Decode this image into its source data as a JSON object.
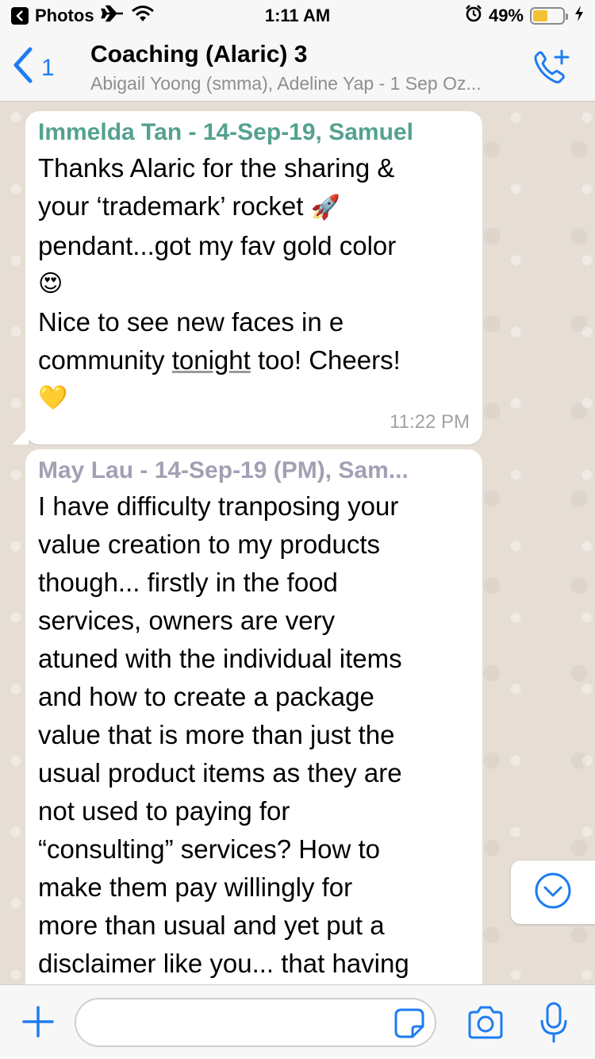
{
  "status_bar": {
    "back_app": "Photos",
    "time": "1:11 AM",
    "battery_percent": "49%",
    "battery_level": 0.49
  },
  "header": {
    "back_count": "1",
    "title": "Coaching (Alaric) 3",
    "subtitle": "Abigail Yoong (smma), Adeline Yap - 1 Sep Oz..."
  },
  "messages": [
    {
      "sender": "Immelda Tan - 14-Sep-19, Samuel",
      "sender_color": "#54a18f",
      "line1": "Thanks Alaric for the sharing &",
      "line2": "your ‘trademark’ rocket",
      "emoji_rocket": "🚀",
      "line3": "pendant...got my fav gold color",
      "emoji_heart_eyes": "😍",
      "line4": "Nice to see new faces in e",
      "line5a": "community",
      "line5b": "tonight",
      "line5c": "too! Cheers!",
      "emoji_yellow_heart": "💛",
      "time": "11:22 PM"
    },
    {
      "sender": "May Lau - 14-Sep-19 (PM), Sam...",
      "sender_color": "#a59fb4",
      "lines": [
        "I have difficulty tranposing your",
        "value creation to my products",
        "though... firstly in the food",
        "services, owners are very",
        "atuned with the individual items",
        "and how to create a package",
        "value that is more than just the",
        "usual product items as they are",
        "not used to paying for",
        "“consulting” services? How to",
        "make them pay willingly for",
        "more than usual and yet put a",
        "disclaimer like you... that having"
      ]
    }
  ],
  "input": {
    "placeholder": ""
  },
  "colors": {
    "accent": "#1e7cf2",
    "chat_background": "#e6ded5",
    "bubble": "#ffffff"
  },
  "icons": [
    "chevron-left-icon",
    "call-add-icon",
    "chevron-down-icon",
    "plus-icon",
    "sticker-icon",
    "camera-icon",
    "mic-icon",
    "airplane-icon",
    "wifi-icon",
    "alarm-icon",
    "battery-icon",
    "charging-icon"
  ]
}
